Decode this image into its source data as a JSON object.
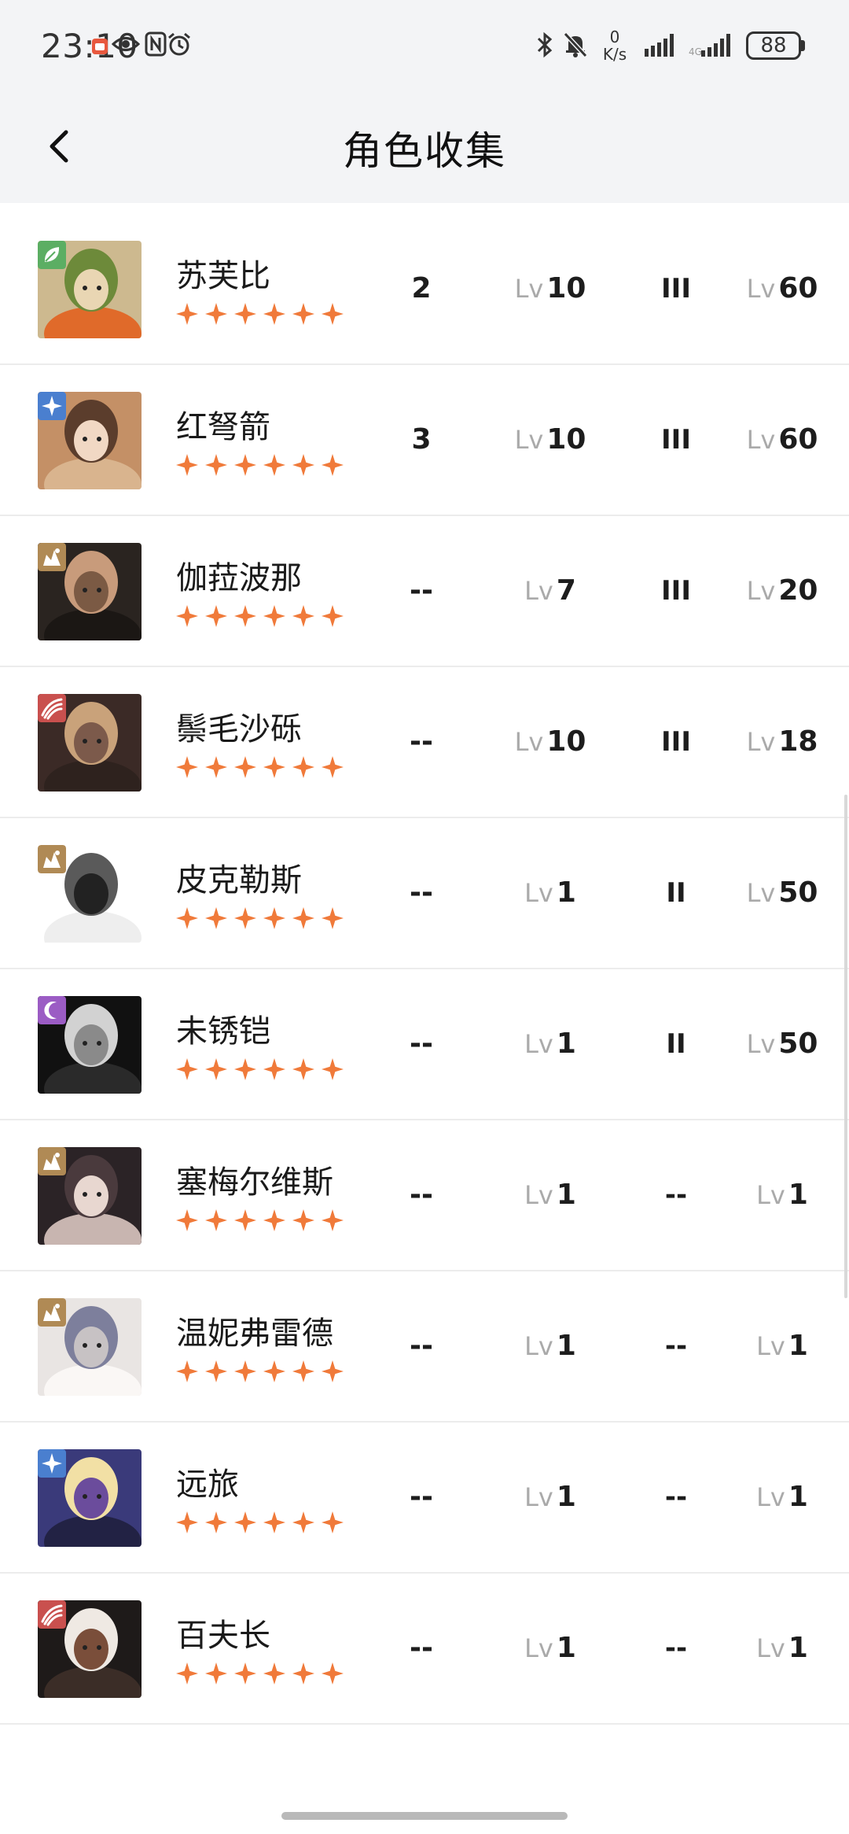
{
  "status_bar": {
    "time": "23:10",
    "net_speed_value": "0",
    "net_speed_unit": "K/s",
    "battery": "88"
  },
  "header": {
    "title": "角色收集"
  },
  "colors": {
    "star": "#f07a3a",
    "level_prefix": "#aaaaaa"
  },
  "level_prefix": "Lv",
  "characters": [
    {
      "name": "苏芙比",
      "element_icon": "leaf-icon",
      "element_color": "#5cae63",
      "stars": 6,
      "col1": "2",
      "level": "10",
      "tier": "III",
      "max_level": "60"
    },
    {
      "name": "红弩箭",
      "element_icon": "star-sparkle-icon",
      "element_color": "#4a7fcf",
      "stars": 6,
      "col1": "3",
      "level": "10",
      "tier": "III",
      "max_level": "60"
    },
    {
      "name": "伽菈波那",
      "element_icon": "earth-icon",
      "element_color": "#b08a55",
      "stars": 6,
      "col1": "--",
      "level": "7",
      "tier": "III",
      "max_level": "20"
    },
    {
      "name": "鬃毛沙砾",
      "element_icon": "beast-icon",
      "element_color": "#c9504e",
      "stars": 6,
      "col1": "--",
      "level": "10",
      "tier": "III",
      "max_level": "18"
    },
    {
      "name": "皮克勒斯",
      "element_icon": "earth-icon",
      "element_color": "#b08a55",
      "stars": 6,
      "col1": "--",
      "level": "1",
      "tier": "II",
      "max_level": "50"
    },
    {
      "name": "未锈铠",
      "element_icon": "moon-icon",
      "element_color": "#9b5cc4",
      "stars": 6,
      "col1": "--",
      "level": "1",
      "tier": "II",
      "max_level": "50"
    },
    {
      "name": "塞梅尔维斯",
      "element_icon": "earth-icon",
      "element_color": "#b08a55",
      "stars": 6,
      "col1": "--",
      "level": "1",
      "tier": "--",
      "max_level": "1"
    },
    {
      "name": "温妮弗雷德",
      "element_icon": "earth-icon",
      "element_color": "#b08a55",
      "stars": 6,
      "col1": "--",
      "level": "1",
      "tier": "--",
      "max_level": "1"
    },
    {
      "name": "远旅",
      "element_icon": "star-sparkle-icon",
      "element_color": "#4a7fcf",
      "stars": 6,
      "col1": "--",
      "level": "1",
      "tier": "--",
      "max_level": "1"
    },
    {
      "name": "百夫长",
      "element_icon": "beast-icon",
      "element_color": "#c9504e",
      "stars": 6,
      "col1": "--",
      "level": "1",
      "tier": "--",
      "max_level": "1"
    }
  ]
}
